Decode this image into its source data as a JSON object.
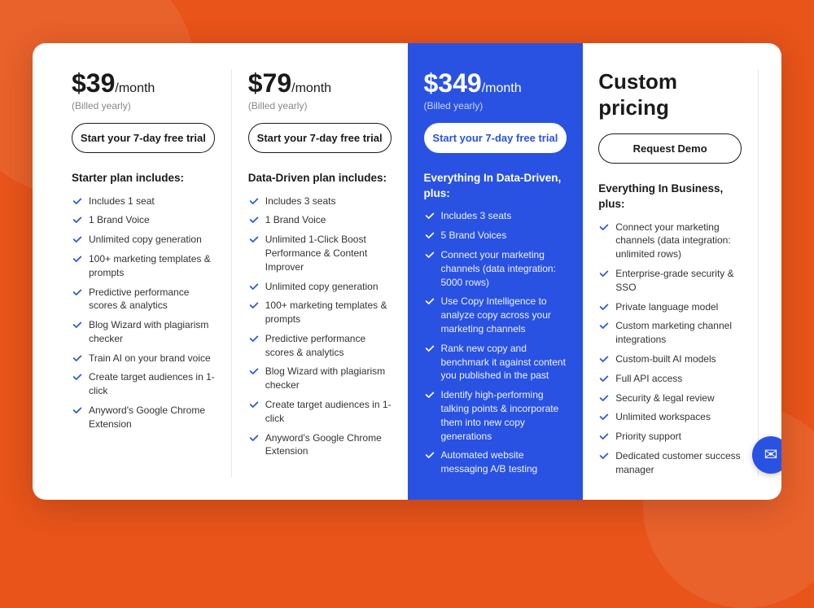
{
  "background": "#e8541a",
  "plans": [
    {
      "id": "starter",
      "price": "$39",
      "period": "/month",
      "billing": "(Billed yearly)",
      "cta": "Start your 7-day free trial",
      "includes_title": "Starter plan includes:",
      "highlighted": false,
      "features": [
        "Includes 1 seat",
        "1 Brand Voice",
        "Unlimited copy generation",
        "100+ marketing templates & prompts",
        "Predictive performance scores & analytics",
        "Blog Wizard with plagiarism checker",
        "Train AI on your brand voice",
        "Create target audiences in 1-click",
        "Anyword's Google Chrome Extension"
      ]
    },
    {
      "id": "data-driven",
      "price": "$79",
      "period": "/month",
      "billing": "(Billed yearly)",
      "cta": "Start your 7-day free trial",
      "includes_title": "Data-Driven plan includes:",
      "highlighted": false,
      "features": [
        "Includes 3 seats",
        "1 Brand Voice",
        "Unlimited 1-Click Boost Performance & Content Improver",
        "Unlimited copy generation",
        "100+ marketing templates & prompts",
        "Predictive performance scores & analytics",
        "Blog Wizard with plagiarism checker",
        "Create target audiences in 1-click",
        "Anyword's Google Chrome Extension"
      ]
    },
    {
      "id": "business",
      "price": "$349",
      "period": "/month",
      "billing": "(Billed yearly)",
      "cta": "Start your 7-day free trial",
      "includes_title": "Everything In Data-Driven, plus:",
      "highlighted": true,
      "features": [
        "Includes 3 seats",
        "5 Brand Voices",
        "Connect your marketing channels (data integration: 5000 rows)",
        "Use Copy Intelligence to analyze copy across your marketing channels",
        "Rank new copy and benchmark it against content you published in the past",
        "Identify high-performing talking points & incorporate them into new copy generations",
        "Automated website messaging A/B testing"
      ]
    },
    {
      "id": "enterprise",
      "price": "Custom pricing",
      "period": "",
      "billing": "",
      "cta": "Request Demo",
      "includes_title": "Everything In Business, plus:",
      "highlighted": false,
      "features": [
        "Connect your marketing channels (data integration: unlimited rows)",
        "Enterprise-grade security & SSO",
        "Private language model",
        "Custom marketing channel integrations",
        "Custom-built AI models",
        "Full API access",
        "Security & legal review",
        "Unlimited workspaces",
        "Priority support",
        "Dedicated customer success manager"
      ]
    }
  ],
  "chat_icon": "✉"
}
